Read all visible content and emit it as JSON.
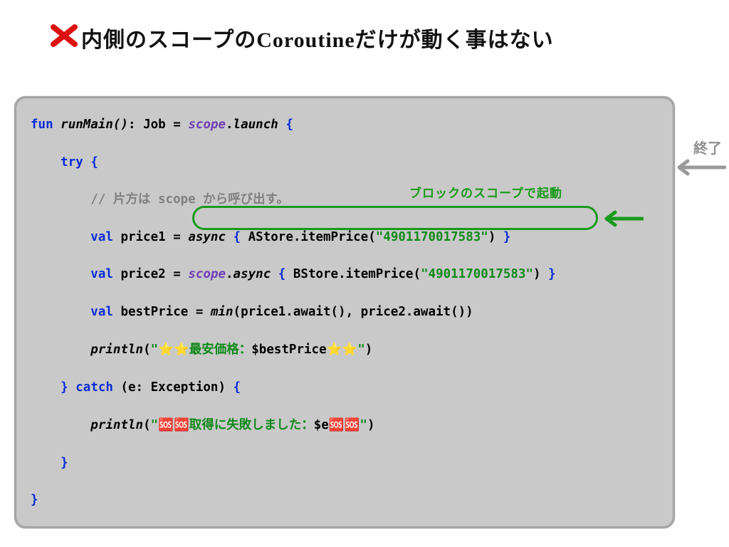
{
  "title": "内側のスコープのCoroutineだけが動く事はない",
  "side_note": "終了",
  "annotation": "ブロックのスコープで起動",
  "code": {
    "line1": {
      "fun": "fun",
      "name": "runMain()",
      "job": "Job",
      "eq": "=",
      "scope": "scope",
      "dot": ".",
      "launch": "launch",
      "brace": "{"
    },
    "line_try": {
      "try": "try",
      "brace": "{"
    },
    "comment": "// 片方は scope から呼び出す。",
    "price1": {
      "val": "val",
      "name": "price1",
      "eq": "=",
      "async": "async",
      "brace1": "{",
      "call": "AStore.itemPrice(",
      "str": "\"4901170017583\"",
      "close": ")",
      "brace2": "}"
    },
    "price2": {
      "val": "val",
      "name": "price2",
      "eq": "=",
      "scope": "scope",
      "dot": ".",
      "async": "async",
      "brace1": "{",
      "call": "BStore.itemPrice(",
      "str": "\"4901170017583\"",
      "close": ")",
      "brace2": "}"
    },
    "best": {
      "val": "val",
      "name": "bestPrice",
      "eq": "=",
      "min": "min",
      "args": "(price1.await(), price2.await())"
    },
    "println1": {
      "fn": "println",
      "open": "(",
      "q1": "\"",
      "star": "⭐⭐",
      "text": "最安価格：",
      "interp": "$bestPrice",
      "star2": "⭐⭐",
      "q2": "\"",
      "close": ")"
    },
    "catch": {
      "brace1": "}",
      "catch": "catch",
      "args": "(e: Exception)",
      "brace2": "{"
    },
    "println2": {
      "fn": "println",
      "open": "(",
      "q1": "\"",
      "err": "🆘🆘",
      "text": "取得に失敗しました：",
      "interp": "$e",
      "err2": "🆘🆘",
      "q2": "\"",
      "close": ")"
    },
    "closebrace1": "}",
    "closebrace_outer": "}"
  }
}
